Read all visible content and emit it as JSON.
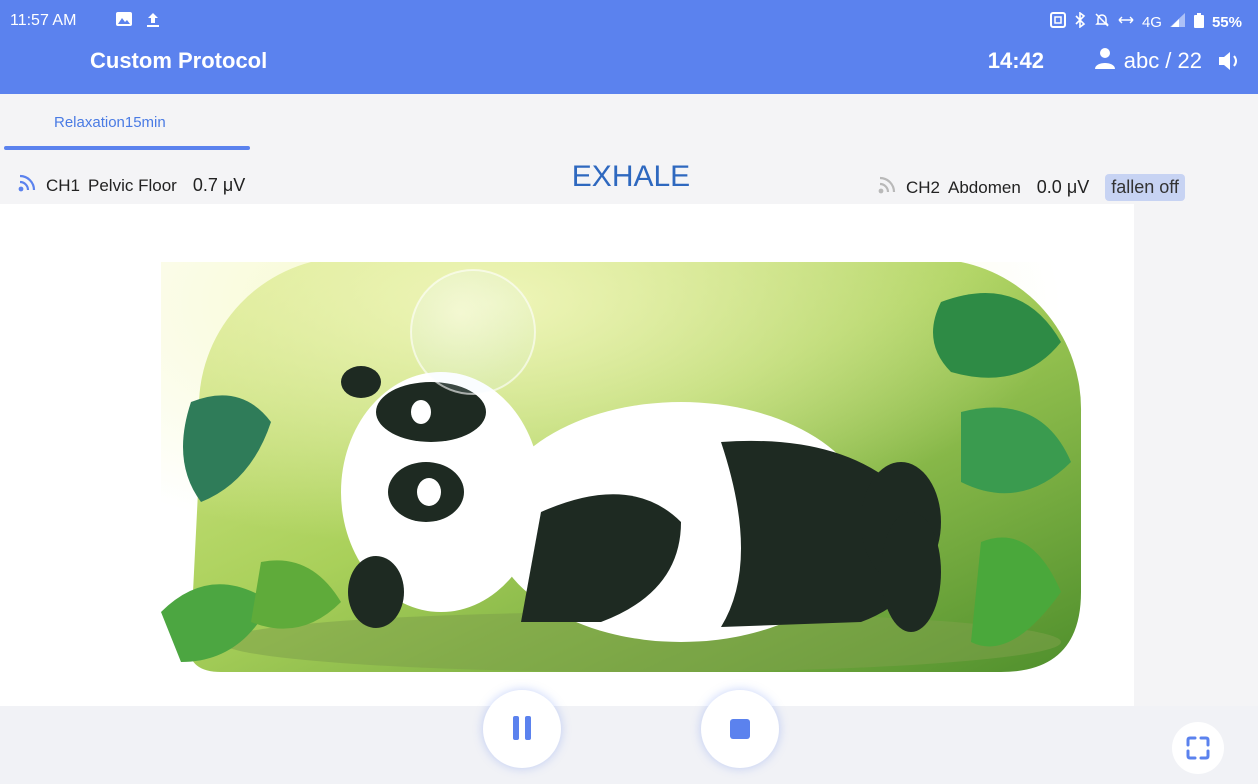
{
  "status_bar": {
    "time": "11:57 AM",
    "network": "4G",
    "battery": "55%",
    "icons": [
      "image-icon",
      "upload-icon",
      "nfc-icon",
      "bluetooth-icon",
      "mute-icon",
      "data-arrows-icon",
      "signal-icon",
      "battery-icon"
    ]
  },
  "app_bar": {
    "title": "Custom Protocol",
    "timer": "14:42",
    "user": "abc / 22",
    "icons": [
      "user-icon",
      "volume-icon"
    ]
  },
  "tabs": [
    {
      "label": "Relaxation15min",
      "active": true
    }
  ],
  "channels": {
    "ch1": {
      "name": "CH1",
      "location": "Pelvic Floor",
      "value": "0.7 μV"
    },
    "ch2": {
      "name": "CH2",
      "location": "Abdomen",
      "value": "0.0 μV",
      "status": "fallen off"
    }
  },
  "phase": "EXHALE",
  "controls": {
    "icons": [
      "pause-icon",
      "stop-icon",
      "fullscreen-icon"
    ]
  },
  "colors": {
    "accent": "#5b82ee",
    "phase_text": "#2e68bf",
    "tab_active": "#4a7be4",
    "badge_bg": "#c7d3f3"
  }
}
